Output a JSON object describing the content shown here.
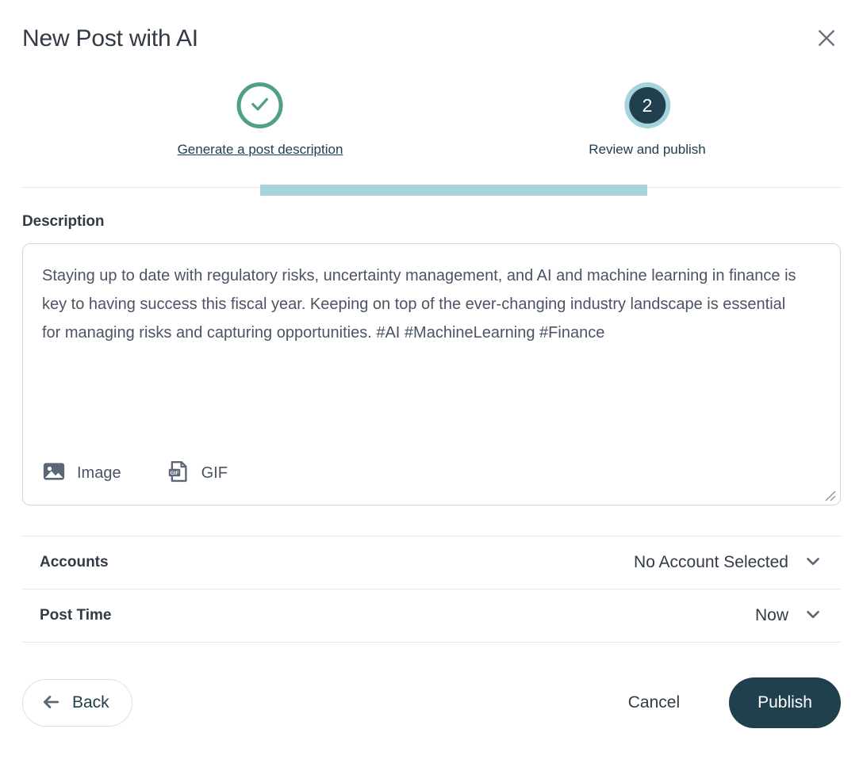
{
  "header": {
    "title": "New Post with AI",
    "close_icon": "close-icon"
  },
  "stepper": {
    "steps": [
      {
        "label": "Generate a post description",
        "state": "completed",
        "marker": "check-icon"
      },
      {
        "label": "Review and publish",
        "state": "current",
        "marker": "2"
      }
    ],
    "line_color": "#a6d3dd",
    "completed_color": "#4fa184",
    "current_color": "#21404e"
  },
  "description": {
    "label": "Description",
    "value": "Staying up to date with regulatory risks, uncertainty management, and AI and machine learning in finance is key to having success this fiscal year. Keeping on top of the ever-changing industry landscape is essential for managing risks and capturing opportunities. #AI #MachineLearning #Finance",
    "placeholder": "",
    "attachments": [
      {
        "label": "Image",
        "icon": "image-icon"
      },
      {
        "label": "GIF",
        "icon": "gif-icon"
      }
    ],
    "resize_handle": "resize-grip-icon"
  },
  "options": [
    {
      "name": "Accounts",
      "value": "No Account Selected",
      "icon": "chevron-down-icon"
    },
    {
      "name": "Post Time",
      "value": "Now",
      "icon": "chevron-down-icon"
    }
  ],
  "footer": {
    "back_label": "Back",
    "back_icon": "arrow-left-icon",
    "cancel_label": "Cancel",
    "publish_label": "Publish"
  },
  "colors": {
    "accent_dark": "#21404e",
    "accent_light": "#a6d3dd",
    "success": "#4fa184",
    "text": "#323a45",
    "muted": "#4a5464",
    "border": "#d4d7da"
  }
}
